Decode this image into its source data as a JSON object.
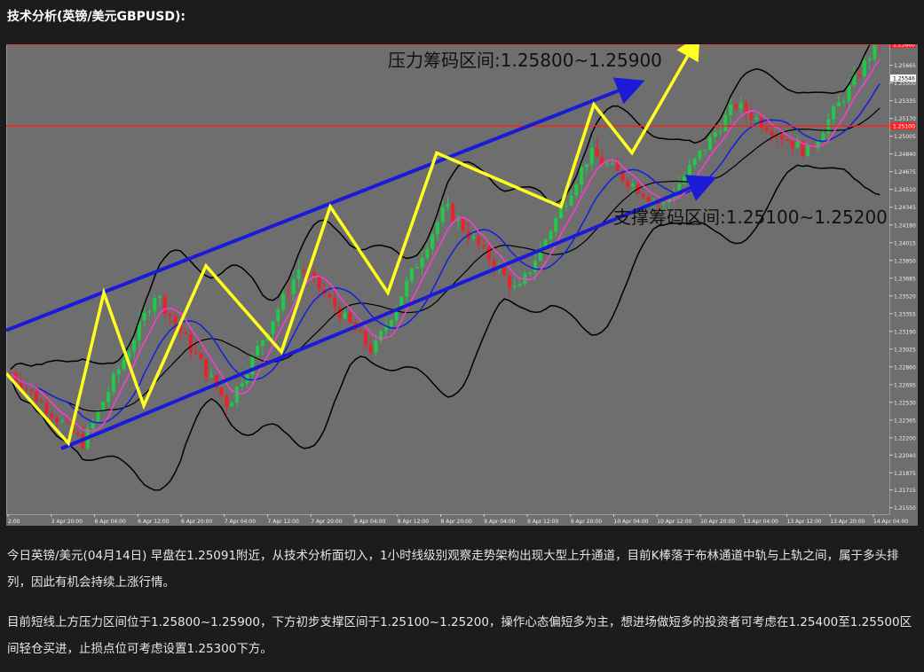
{
  "heading": "技术分析(英镑/美元GBPUSD):",
  "paragraphs": [
    "今日英镑/美元(04月14日) 早盘在1.25091附近，从技术分析面切入，1小时线级别观察走势架构出现大型上升通道，目前K棒落于布林通道中轨与上轨之间，属于多头排列，因此有机会持续上涨行情。",
    "目前短线上方压力区间位于1.25800~1.25900，下方初步支撑区间于1.25100~1.25200，操作心态偏短多为主，想进场做短多的投资者可考虑在1.25400至1.25500区间轻仓买进，止损点位可考虑设置1.25300下方。"
  ],
  "chart_data": {
    "type": "line",
    "background": "#6e6e6e",
    "annotations": {
      "resistance_label": "压力筹码区间:1.25800~1.25900",
      "support_label": "支撑筹码区间:1.25100~1.25200"
    },
    "y_ticks": [
      "1.25665",
      "1.25500",
      "1.25335",
      "1.25170",
      "1.25005",
      "1.24840",
      "1.24675",
      "1.24510",
      "1.24345",
      "1.24180",
      "1.24015",
      "1.23850",
      "1.23685",
      "1.23520",
      "1.23355",
      "1.23190",
      "1.23025",
      "1.22860",
      "1.22695",
      "1.22530",
      "1.22365",
      "1.22200",
      "1.22040",
      "1.21875",
      "1.21715",
      "1.21550"
    ],
    "ylim": [
      1.2149,
      1.2586
    ],
    "price_tags": {
      "resistance": "1.25860",
      "current": "1.25546",
      "support": "1.25100"
    },
    "x_ticks": [
      "2:00",
      "3 Apr 20:00",
      "6 Apr 04:00",
      "6 Apr 12:00",
      "6 Apr 20:00",
      "7 Apr 04:00",
      "7 Apr 12:00",
      "7 Apr 20:00",
      "8 Apr 04:00",
      "8 Apr 12:00",
      "8 Apr 20:00",
      "9 Apr 04:00",
      "9 Apr 12:00",
      "9 Apr 20:00",
      "10 Apr 04:00",
      "10 Apr 12:00",
      "10 Apr 20:00",
      "13 Apr 04:00",
      "13 Apr 12:00",
      "13 Apr 20:00",
      "14 Apr 04:00"
    ],
    "horizontal_lines": [
      1.2586,
      1.251
    ],
    "wave_path": [
      1.228,
      1.2215,
      1.2355,
      1.225,
      1.238,
      1.23,
      1.2435,
      1.2355,
      1.2485,
      1.2435,
      1.253,
      1.2485,
      1.259
    ],
    "channel_upper": [
      1.232,
      1.255
    ],
    "channel_lower": [
      1.221,
      1.246
    ],
    "colors": {
      "grid": "#808080",
      "candle_up": "#22c84a",
      "candle_down": "#e8232a",
      "band": "#000000",
      "ma_fast": "#ff3cd2",
      "ma_slow": "#1020e0",
      "channel": "#1a1ad8",
      "wave": "#ffff20",
      "hline": "#ff2020"
    }
  }
}
